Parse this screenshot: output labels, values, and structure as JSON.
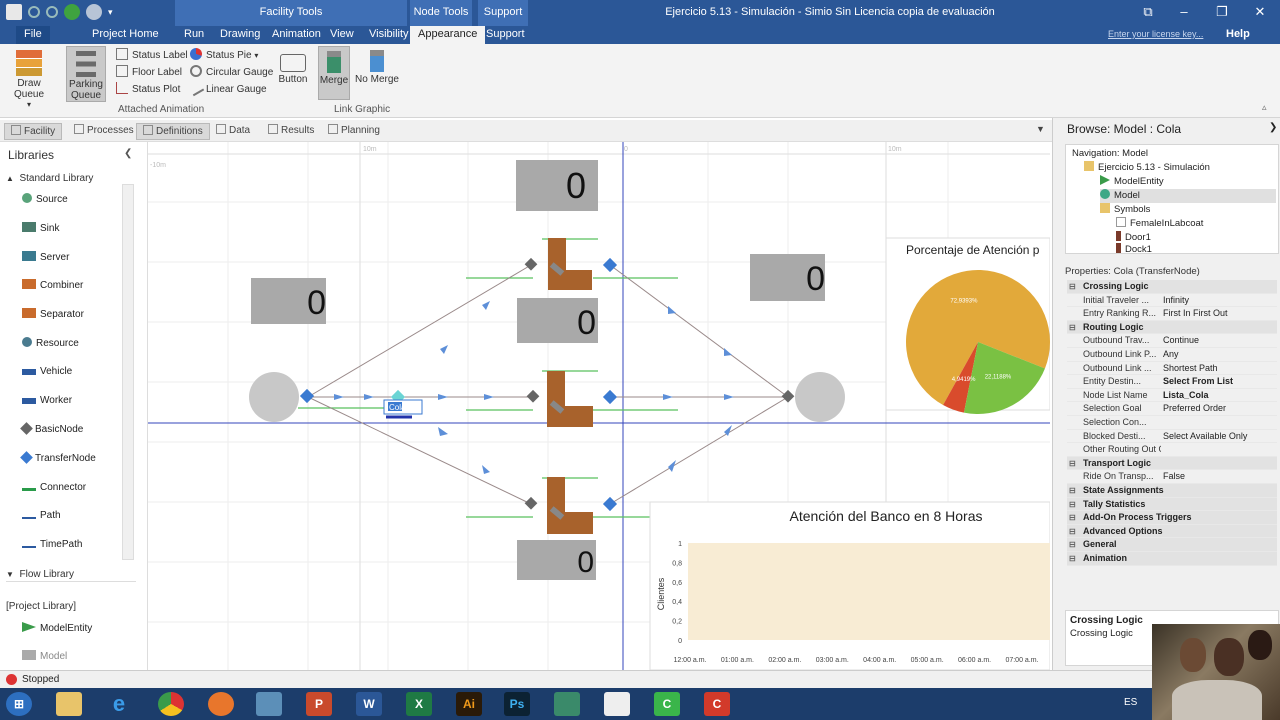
{
  "titlebar": {
    "context_facility": "Facility Tools",
    "context_node": "Node Tools",
    "context_support": "Support",
    "window_title": "Ejercicio 5.13 - Simulación - Simio Sin Licencia copia de evaluación"
  },
  "tabs": [
    "File",
    "Project Home",
    "Run",
    "Drawing",
    "Animation",
    "View",
    "Visibility",
    "Appearance",
    "Support"
  ],
  "license_link": "Enter your license key...",
  "help": "Help",
  "ribbon": {
    "draw_queue": "Draw Queue",
    "parking_queue": "Parking Queue",
    "status_label": "Status Label",
    "floor_label": "Floor Label",
    "status_plot": "Status Plot",
    "status_pie": "Status Pie",
    "circular_gauge": "Circular Gauge",
    "linear_gauge": "Linear Gauge",
    "button": "Button",
    "merge": "Merge",
    "no_merge": "No Merge",
    "group_attached": "Attached Animation",
    "group_link": "Link Graphic"
  },
  "view_tabs": [
    "Facility",
    "Processes",
    "Definitions",
    "Data",
    "Results",
    "Planning"
  ],
  "libraries": {
    "title": "Libraries",
    "standard": "Standard Library",
    "items": [
      "Source",
      "Sink",
      "Server",
      "Combiner",
      "Separator",
      "Resource",
      "Vehicle",
      "Worker",
      "BasicNode",
      "TransferNode",
      "Connector",
      "Path",
      "TimePath"
    ],
    "flow": "Flow Library",
    "project": "[Project Library]",
    "project_items": [
      "ModelEntity",
      "Model"
    ]
  },
  "canvas": {
    "status_values": [
      "0",
      "0",
      "0",
      "0",
      "0"
    ],
    "node_label": "Cola",
    "ruler_labels": [
      "10m",
      "0",
      "10m",
      "-10m"
    ],
    "pie_title": "Porcentaje de Atención p",
    "pie_labels": [
      "72,9393%",
      "4,9419%",
      "22,1188%"
    ],
    "plot_title": "Atención del Banco en 8 Horas"
  },
  "chart_data": [
    {
      "type": "pie",
      "title": "Porcentaje de Atención p",
      "labels": [
        "72,9393%",
        "4,9419%",
        "22,1188%"
      ],
      "values": [
        72.9393,
        4.9419,
        22.1188
      ],
      "colors": [
        "#e2a93a",
        "#d94b2c",
        "#7ac143"
      ]
    },
    {
      "type": "line",
      "title": "Atención del Banco en 8 Horas",
      "ylabel": "Clientes",
      "xlabel": "",
      "ylim": [
        0,
        1
      ],
      "yticks": [
        "1",
        "0,8",
        "0,6",
        "0,4",
        "0,2",
        "0"
      ],
      "xticks": [
        "12:00 a.m.",
        "01:00 a.m.",
        "02:00 a.m.",
        "03:00 a.m.",
        "04:00 a.m.",
        "05:00 a.m.",
        "06:00 a.m.",
        "07:00 a.m."
      ],
      "series": []
    }
  ],
  "browse": {
    "title": "Browse: Model : Cola",
    "nav_label": "Navigation: Model",
    "tree": [
      "Ejercicio 5.13 - Simulación",
      "ModelEntity",
      "Model",
      "Symbols",
      "FemaleInLabcoat",
      "Door1",
      "Dock1"
    ]
  },
  "properties": {
    "header": "Properties: Cola (TransferNode)",
    "rows": [
      {
        "cat": true,
        "k": "Crossing Logic"
      },
      {
        "k": "Initial Traveler ...",
        "v": "Infinity"
      },
      {
        "k": "Entry Ranking R...",
        "v": "First In First Out"
      },
      {
        "cat": true,
        "k": "Routing Logic"
      },
      {
        "k": "Outbound Trav...",
        "v": "Continue"
      },
      {
        "k": "Outbound Link P...",
        "v": "Any"
      },
      {
        "k": "Outbound Link ...",
        "v": "Shortest Path"
      },
      {
        "k": "Entity Destin...",
        "v": "Select From List"
      },
      {
        "k": "Node List Name",
        "v": "Lista_Cola"
      },
      {
        "k": "Selection Goal",
        "v": "Preferred Order"
      },
      {
        "k": "Selection Con...",
        "v": ""
      },
      {
        "k": "Blocked Desti...",
        "v": "Select Available Only"
      },
      {
        "k": "Other Routing Out Options",
        "v": ""
      },
      {
        "cat": true,
        "k": "Transport Logic"
      },
      {
        "k": "Ride On Transp...",
        "v": "False"
      },
      {
        "cat": true,
        "k": "State Assignments"
      },
      {
        "cat": true,
        "k": "Tally Statistics"
      },
      {
        "cat": true,
        "k": "Add-On Process Triggers"
      },
      {
        "cat": true,
        "k": "Advanced Options"
      },
      {
        "cat": true,
        "k": "General"
      },
      {
        "cat": true,
        "k": "Animation"
      }
    ],
    "desc_title": "Crossing Logic",
    "desc_text": "Crossing Logic"
  },
  "status": "Stopped",
  "taskbar": {
    "lang": "ES"
  }
}
